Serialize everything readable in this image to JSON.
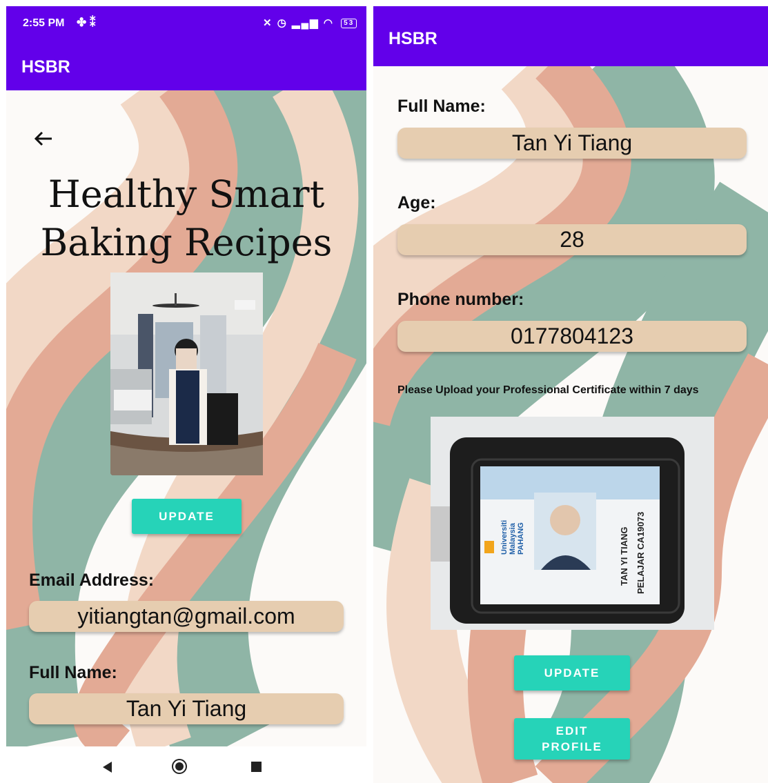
{
  "left_screen": {
    "status_bar": {
      "time": "2:55 PM",
      "left_icons": [
        "fan-icon",
        "steps-icon"
      ],
      "right_icons": [
        "alarm-off-icon",
        "alarm-icon",
        "signal-icon",
        "wifi-icon",
        "battery-icon"
      ],
      "battery_level": "53"
    },
    "app_title": "HSBR",
    "heading_line1": "Healthy Smart",
    "heading_line2": "Baking Recipes",
    "update_button": "UPDATE",
    "email_label": "Email Address:",
    "email_value": "yitiangtan@gmail.com",
    "fullname_label": "Full Name:",
    "fullname_value": "Tan Yi Tiang"
  },
  "right_screen": {
    "app_title": "HSBR",
    "fullname_label": "Full Name:",
    "fullname_value": "Tan Yi Tiang",
    "age_label": "Age:",
    "age_value": "28",
    "phone_label": "Phone number:",
    "phone_value": "0177804123",
    "notice": "Please Upload your Professional Certificate within 7 days",
    "certificate": {
      "university_line1": "Universiti",
      "university_line2": "Malaysia",
      "university_line3": "PAHANG",
      "card_name": "TAN YI TIANG",
      "card_id": "PELAJAR CA19073"
    },
    "update_button": "UPDATE",
    "edit_profile_button": "EDIT\nPROFILE"
  },
  "nav_bar": {
    "icons": [
      "back-icon",
      "home-icon",
      "recents-icon"
    ]
  },
  "colors": {
    "app_bar": "#6200ea",
    "button": "#26d3b8",
    "field_bg": "#e6cdb0",
    "wave_green": "#8fb5a6",
    "wave_peach": "#f2d8c6",
    "wave_salmon": "#e3aa95"
  }
}
